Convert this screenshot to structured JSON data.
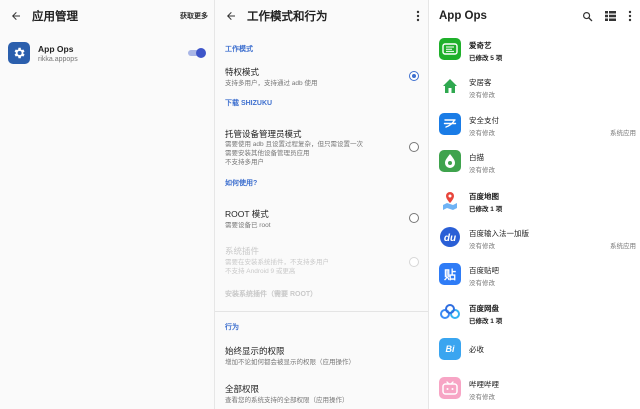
{
  "pane1": {
    "title": "应用管理",
    "action": "获取更多",
    "app": {
      "name": "App Ops",
      "package": "rikka.appops",
      "enabled": true
    }
  },
  "pane2": {
    "title": "工作模式和行为",
    "sections": {
      "mode": "工作模式",
      "behavior": "行为"
    },
    "options": {
      "privileged": {
        "title": "特权模式",
        "subtitle": "支持多用户，支持通过 adb 使用"
      },
      "download_shizuku": "下载 SHIZUKU",
      "device_admin": {
        "title": "托管设备管理员模式",
        "line1": "需要使用 adb 且设置过程复杂，但只需设置一次",
        "line2": "需要安装其他设备管理员应用",
        "line3": "不支持多用户"
      },
      "how_to_use": "如何使用?",
      "root": {
        "title": "ROOT 模式",
        "subtitle": "需要设备已 root"
      },
      "system_plugin": {
        "title": "系统插件",
        "line1": "需要在安装系统插件，不支持多用户",
        "line2": "不支持 Android 9 或更高"
      },
      "install_plugin": "安装系统插件（需要 ROOT）",
      "always_show": {
        "title": "始终显示的权限",
        "subtitle": "增加不论如何都会被显示的权限（应用操作）"
      },
      "all_permissions": {
        "title": "全部权限",
        "subtitle": "查看您的系统支持的全部权限（应用操作）"
      }
    },
    "selected": "privileged"
  },
  "pane3": {
    "title": "App Ops",
    "apps": [
      {
        "name": "爱奇艺",
        "status": "已修改 5 项",
        "modified": true,
        "tag": "",
        "icon": "iqiyi-icon",
        "color": "#1fb02b"
      },
      {
        "name": "安居客",
        "status": "没有修改",
        "modified": false,
        "tag": "",
        "icon": "anjuke-icon",
        "color": "#ffffff"
      },
      {
        "name": "安全支付",
        "status": "没有修改",
        "modified": false,
        "tag": "系统应用",
        "icon": "alipay-icon",
        "color": "#1a7ce6"
      },
      {
        "name": "白描",
        "status": "没有修改",
        "modified": false,
        "tag": "",
        "icon": "baimiao-icon",
        "color": "#3fa34d"
      },
      {
        "name": "百度地图",
        "status": "已修改 1 项",
        "modified": true,
        "tag": "",
        "icon": "baidu-map-icon",
        "color": "#ffffff"
      },
      {
        "name": "百度输入法一加版",
        "status": "没有修改",
        "modified": false,
        "tag": "系统应用",
        "icon": "baidu-input-icon",
        "color": "#2a5fd6"
      },
      {
        "name": "百度贴吧",
        "status": "没有修改",
        "modified": false,
        "tag": "",
        "icon": "tieba-icon",
        "color": "#2f7cf6"
      },
      {
        "name": "百度网盘",
        "status": "已修改 1 项",
        "modified": true,
        "tag": "",
        "icon": "baidu-netdisk-icon",
        "color": "#ffffff"
      },
      {
        "name": "必收",
        "status": "",
        "modified": false,
        "tag": "",
        "icon": "bishou-icon",
        "color": "#3aa5f0"
      },
      {
        "name": "哔哩哔哩",
        "status": "没有修改",
        "modified": false,
        "tag": "",
        "icon": "bilibili-icon",
        "color": "#f7a5c5"
      }
    ]
  }
}
